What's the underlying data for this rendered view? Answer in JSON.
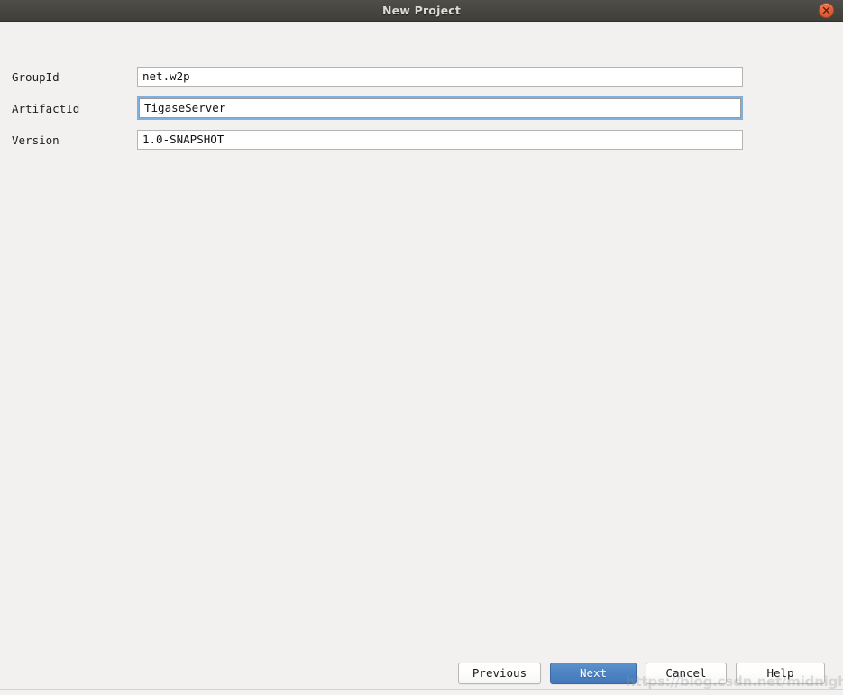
{
  "window": {
    "title": "New Project",
    "close_icon": "close-icon",
    "titlebar_color": "#47453f",
    "background_color": "#f2f1f0"
  },
  "form": {
    "fields": [
      {
        "label": "GroupId",
        "value": "net.w2p",
        "placeholder": "",
        "focused": false
      },
      {
        "label": "ArtifactId",
        "value": "TigaseServer",
        "placeholder": "",
        "focused": true
      },
      {
        "label": "Version",
        "value": "1.0-SNAPSHOT",
        "placeholder": "",
        "focused": false
      }
    ]
  },
  "buttons": {
    "previous": "Previous",
    "next": "Next",
    "cancel": "Cancel",
    "help": "Help",
    "primary_color": "#4d83c2"
  },
  "watermark": {
    "text": "https://blog.csdn.net/midnight"
  }
}
